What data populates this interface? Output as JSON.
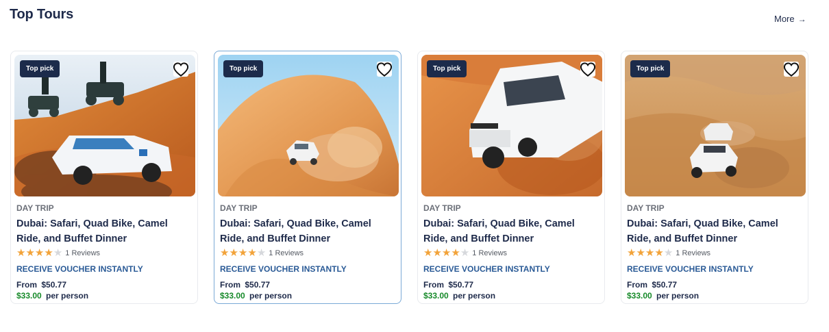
{
  "section": {
    "title": "Top Tours",
    "more_label": "More"
  },
  "colors": {
    "accent_navy": "#1c2b4b",
    "price_green": "#178a2a",
    "star": "#f2a33a",
    "voucher_blue": "#2a5a96"
  },
  "cards": [
    {
      "badge": "Top pick",
      "image": "desert-quad-bike-photo",
      "category": "DAY TRIP",
      "title": "Dubai: Safari, Quad Bike, Camel Ride, and Buffet Dinner",
      "rating": 4,
      "reviews": "1 Reviews",
      "voucher": "RECEIVE VOUCHER INSTANTLY",
      "from_label": "From",
      "original_price": "$50.77",
      "price": "$33.00",
      "per": "per person"
    },
    {
      "badge": "Top pick",
      "image": "dune-bashing-photo",
      "category": "DAY TRIP",
      "title": "Dubai: Safari, Quad Bike, Camel Ride, and Buffet Dinner",
      "rating": 4,
      "reviews": "1 Reviews",
      "voucher": "RECEIVE VOUCHER INSTANTLY",
      "from_label": "From",
      "original_price": "$50.77",
      "price": "$33.00",
      "per": "per person"
    },
    {
      "badge": "Top pick",
      "image": "white-suv-dune-photo",
      "category": "DAY TRIP",
      "title": "Dubai: Safari, Quad Bike, Camel Ride, and Buffet Dinner",
      "rating": 4,
      "reviews": "1 Reviews",
      "voucher": "RECEIVE VOUCHER INSTANTLY",
      "from_label": "From",
      "original_price": "$50.77",
      "price": "$33.00",
      "per": "per person"
    },
    {
      "badge": "Top pick",
      "image": "desert-convoy-photo",
      "category": "DAY TRIP",
      "title": "Dubai: Safari, Quad Bike, Camel Ride, and Buffet Dinner",
      "rating": 4,
      "reviews": "1 Reviews",
      "voucher": "RECEIVE VOUCHER INSTANTLY",
      "from_label": "From",
      "original_price": "$50.77",
      "price": "$33.00",
      "per": "per person"
    }
  ]
}
